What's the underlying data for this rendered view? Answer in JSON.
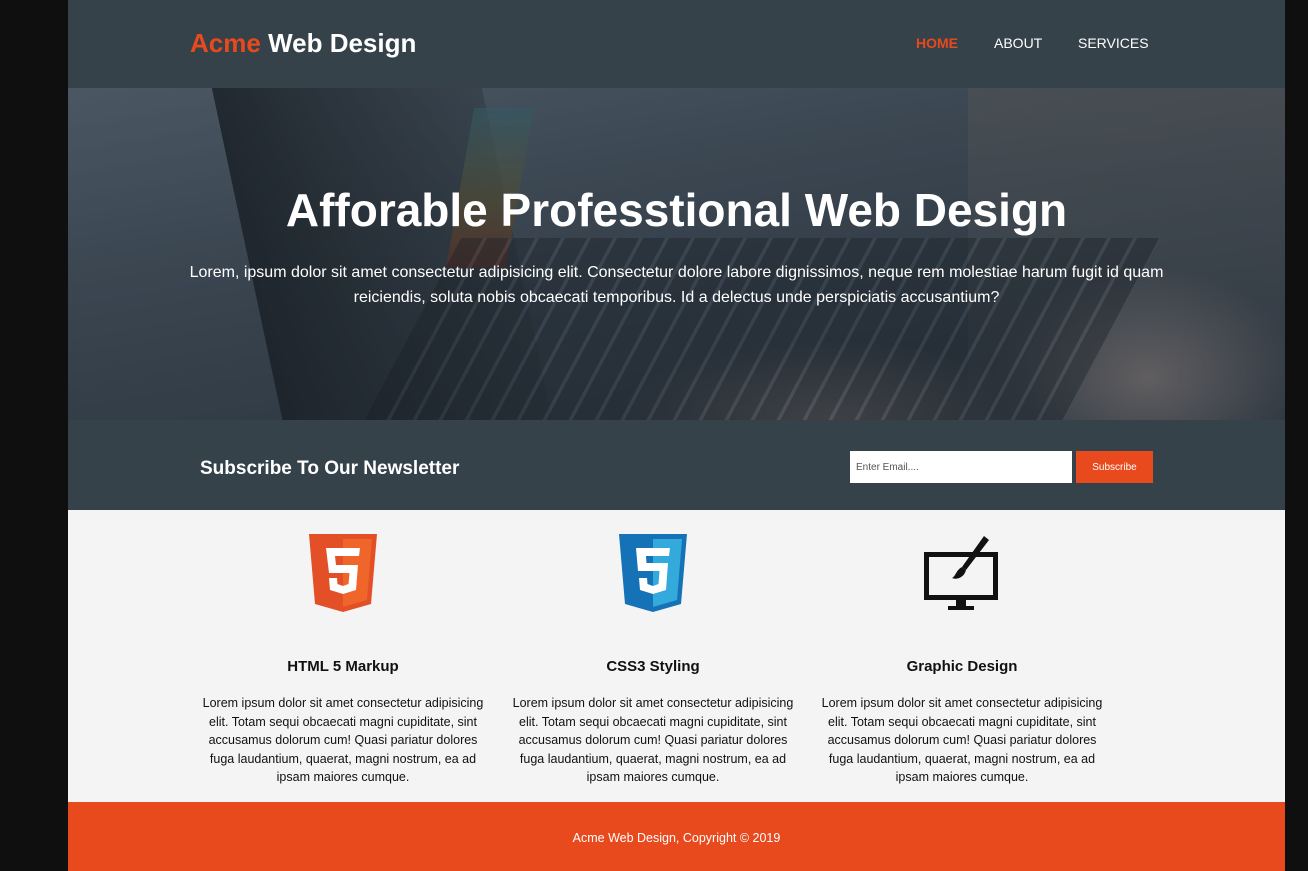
{
  "header": {
    "brand_accent": "Acme",
    "brand_rest": "Web Design",
    "nav": [
      "HOME",
      "ABOUT",
      "SERVICES"
    ]
  },
  "showcase": {
    "title": "Afforable Professtional Web Design",
    "text": "Lorem, ipsum dolor sit amet consectetur adipisicing elit. Consectetur dolore labore dignissimos, neque rem molestiae harum fugit id quam reiciendis, soluta nobis obcaecati temporibus. Id a delectus unde perspiciatis accusantium?"
  },
  "newsletter": {
    "title": "Subscribe To Our Newsletter",
    "email_placeholder": "Enter Email....",
    "button_label": "Subscribe"
  },
  "boxes": [
    {
      "icon": "html5-icon",
      "title": "HTML 5 Markup",
      "text": "Lorem ipsum dolor sit amet consectetur adipisicing elit. Totam sequi obcaecati magni cupiditate, sint accusamus dolorum cum! Quasi pariatur dolores fuga laudantium, quaerat, magni nostrum, ea ad ipsam maiores cumque."
    },
    {
      "icon": "css3-icon",
      "title": "CSS3 Styling",
      "text": "Lorem ipsum dolor sit amet consectetur adipisicing elit. Totam sequi obcaecati magni cupiditate, sint accusamus dolorum cum! Quasi pariatur dolores fuga laudantium, quaerat, magni nostrum, ea ad ipsam maiores cumque."
    },
    {
      "icon": "graphic-design-icon",
      "title": "Graphic Design",
      "text": "Lorem ipsum dolor sit amet consectetur adipisicing elit. Totam sequi obcaecati magni cupiditate, sint accusamus dolorum cum! Quasi pariatur dolores fuga laudantium, quaerat, magni nostrum, ea ad ipsam maiores cumque."
    }
  ],
  "footer": {
    "text": "Acme Web Design, Copyright © 2019"
  },
  "colors": {
    "accent": "#e8491d",
    "dark": "#35424a",
    "light": "#f4f4f4"
  }
}
